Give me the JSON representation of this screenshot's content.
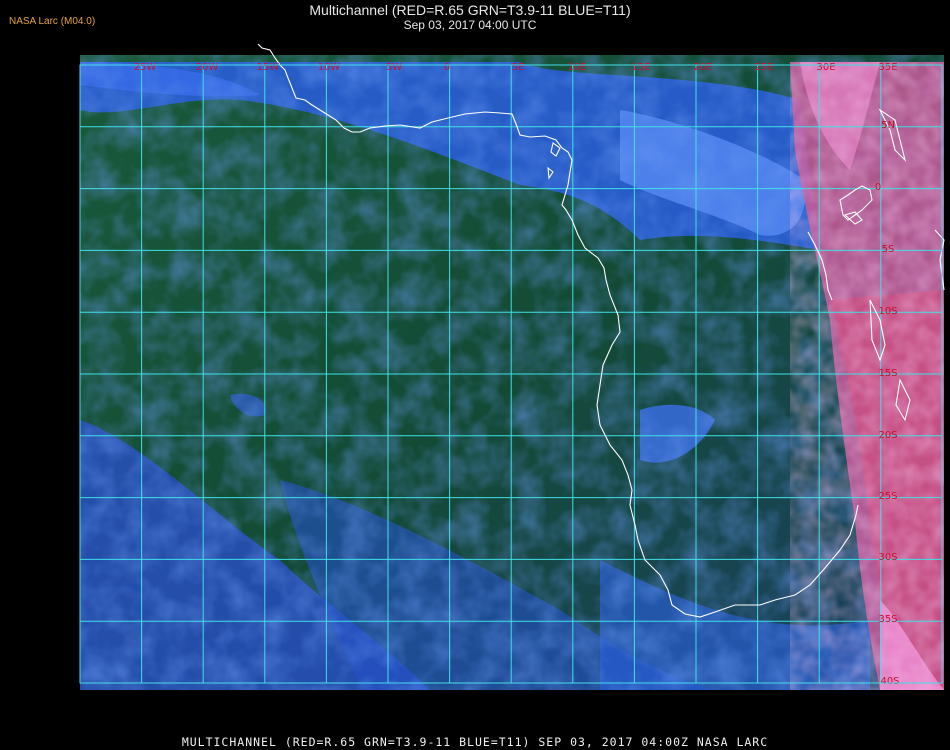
{
  "header": {
    "badge": "NASA Larc (M04.0)",
    "title": "Multichannel (RED=R.65 GRN=T3.9-11 BLUE=T11)",
    "subtitle": "Sep 03, 2017 04:00 UTC"
  },
  "map": {
    "longitude_labels": [
      "25W",
      "20W",
      "15W",
      "10W",
      "5W",
      "0",
      "5E",
      "10E",
      "15E",
      "20E",
      "25E",
      "30E",
      "35E"
    ],
    "latitude_labels": [
      "5N",
      "0",
      "5S",
      "10S",
      "15S",
      "20S",
      "25S",
      "30S",
      "35S",
      "40S"
    ],
    "colors": {
      "grid": "#40e0e8",
      "coastline": "#ffffff",
      "label": "#c8102e",
      "ocean": "#0f4a2a",
      "cloud": "#2858d8",
      "land": "#e060a8"
    }
  },
  "footer": {
    "text": "MULTICHANNEL (RED=R.65 GRN=T3.9-11 BLUE=T11) SEP 03, 2017 04:00Z   NASA LARC"
  }
}
